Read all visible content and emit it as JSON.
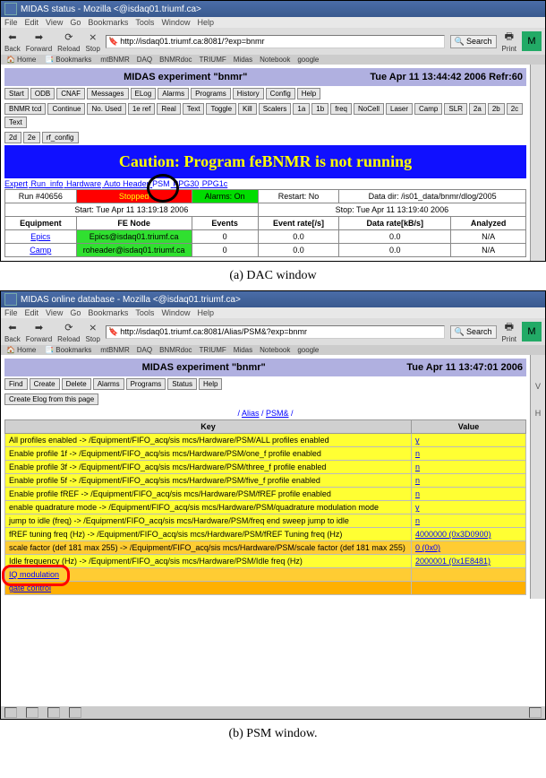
{
  "win1": {
    "title": "MIDAS status - Mozilla <@isdaq01.triumf.ca>",
    "menu": [
      "File",
      "Edit",
      "View",
      "Go",
      "Bookmarks",
      "Tools",
      "Window",
      "Help"
    ],
    "tb": {
      "back": "Back",
      "forward": "Forward",
      "reload": "Reload",
      "stop": "Stop",
      "print": "Print",
      "search": "Search"
    },
    "addr": "http://isdaq01.triumf.ca:8081/?exp=bnmr",
    "links": [
      "Home",
      "Bookmarks",
      "mtBNMR",
      "DAQ",
      "BNMRdoc",
      "TRIUMF",
      "Midas",
      "Notebook",
      "google"
    ],
    "banner": {
      "left": "MIDAS experiment \"bnmr\"",
      "right": "Tue Apr 11 13:44:42 2006    Refr:60"
    },
    "row1": [
      "Start",
      "ODB",
      "CNAF",
      "Messages",
      "ELog",
      "Alarms",
      "Programs",
      "History",
      "Config",
      "Help"
    ],
    "row2": [
      "BNMR tcd",
      "Continue",
      "No. Used",
      "1e ref",
      "Real",
      "Text",
      "Toggle",
      "Kill",
      "Scalers",
      "1a",
      "1b",
      "freq",
      "NoCell",
      "Laser",
      "Camp",
      "SLR",
      "2a",
      "2b",
      "2c",
      "Text"
    ],
    "row3": [
      "2d",
      "2e",
      "rf_config"
    ],
    "caution": "Caution: Program feBNMR is not running",
    "nav": {
      "expert": "Expert",
      "run": "Run_info",
      "hw": "Hardware",
      "ah": "Auto Header",
      "psm": "PSM",
      "ppg30": "PPG30",
      "ppg1c": "PPG1c"
    },
    "status": {
      "run": "Run #40656",
      "stopped": "Stopped",
      "alarms": "Alarms: On",
      "restart": "Restart: No",
      "datadir": "Data dir: /is01_data/bnmr/dlog/2005"
    },
    "times": {
      "start": "Start: Tue Apr 11 13:19:18 2006",
      "stop": "Stop: Tue Apr 11 13:19:40 2006"
    },
    "hdr": {
      "eq": "Equipment",
      "fe": "FE Node",
      "ev": "Events",
      "rate": "Event rate[/s]",
      "data": "Data rate[kB/s]",
      "an": "Analyzed"
    },
    "rows": [
      {
        "eq": "Epics",
        "fe": "Epics@isdaq01.triumf.ca",
        "ev": "0",
        "rate": "0.0",
        "data": "0.0",
        "an": "N/A"
      },
      {
        "eq": "Camp",
        "fe": "roheader@isdaq01.triumf.ca",
        "ev": "0",
        "rate": "0.0",
        "data": "0.0",
        "an": "N/A"
      }
    ]
  },
  "cap1": "(a) DAC window",
  "win2": {
    "title": "MIDAS online database - Mozilla <@isdaq01.triumf.ca>",
    "menu": [
      "File",
      "Edit",
      "View",
      "Go",
      "Bookmarks",
      "Tools",
      "Window",
      "Help"
    ],
    "tb": {
      "back": "Back",
      "forward": "Forward",
      "reload": "Reload",
      "stop": "Stop",
      "print": "Print",
      "search": "Search"
    },
    "addr": "http://isdaq01.triumf.ca:8081/Alias/PSM&?exp=bnmr",
    "links": [
      "Home",
      "Bookmarks",
      "mtBNMR",
      "DAQ",
      "BNMRdoc",
      "TRIUMF",
      "Midas",
      "Notebook",
      "google"
    ],
    "banner": {
      "left": "MIDAS experiment \"bnmr\"",
      "right": "Tue Apr 11 13:47:01 2006"
    },
    "row1": [
      "Find",
      "Create",
      "Delete",
      "Alarms",
      "Programs",
      "Status",
      "Help"
    ],
    "row2b": "Create Elog from this page",
    "crumb": {
      "sep": "/ ",
      "alias": "Alias",
      "psm": "PSM&"
    },
    "hdr": {
      "key": "Key",
      "val": "Value"
    },
    "rows": [
      {
        "k": "All profiles enabled -> /Equipment/FIFO_acq/sis mcs/Hardware/PSM/ALL profiles enabled",
        "v": "y"
      },
      {
        "k": "Enable profile 1f -> /Equipment/FIFO_acq/sis mcs/Hardware/PSM/one_f profile enabled",
        "v": "n"
      },
      {
        "k": "Enable profile 3f -> /Equipment/FIFO_acq/sis mcs/Hardware/PSM/three_f profile enabled",
        "v": "n"
      },
      {
        "k": "Enable profile 5f -> /Equipment/FIFO_acq/sis mcs/Hardware/PSM/five_f profile enabled",
        "v": "n"
      },
      {
        "k": "Enable profile fREF -> /Equipment/FIFO_acq/sis mcs/Hardware/PSM/fREF profile enabled",
        "v": "n"
      },
      {
        "k": "enable quadrature mode -> /Equipment/FIFO_acq/sis mcs/Hardware/PSM/quadrature modulation mode",
        "v": "y"
      },
      {
        "k": "jump to idle (freq) -> /Equipment/FIFO_acq/sis mcs/Hardware/PSM/freq end sweep jump to idle",
        "v": "n"
      },
      {
        "k": "fREF tuning freq (Hz) -> /Equipment/FIFO_acq/sis mcs/Hardware/PSM/fREF Tuning freq (Hz)",
        "v": "4000000 (0x3D0900)"
      },
      {
        "k": "scale factor (def 181 max 255) -> /Equipment/FIFO_acq/sis mcs/Hardware/PSM/scale factor (def 181 max 255)",
        "v": "0 (0x0)",
        "cls": "org"
      },
      {
        "k": "Idle frequency (Hz) -> /Equipment/FIFO_acq/sis mcs/Hardware/PSM/Idle freq (Hz)",
        "v": "2000001 (0x1E8481)"
      },
      {
        "k": "IQ modulation",
        "v": "",
        "cls": "org"
      },
      {
        "k": "gate control",
        "v": "",
        "cls": "org2"
      }
    ]
  },
  "cap2": "(b) PSM window."
}
